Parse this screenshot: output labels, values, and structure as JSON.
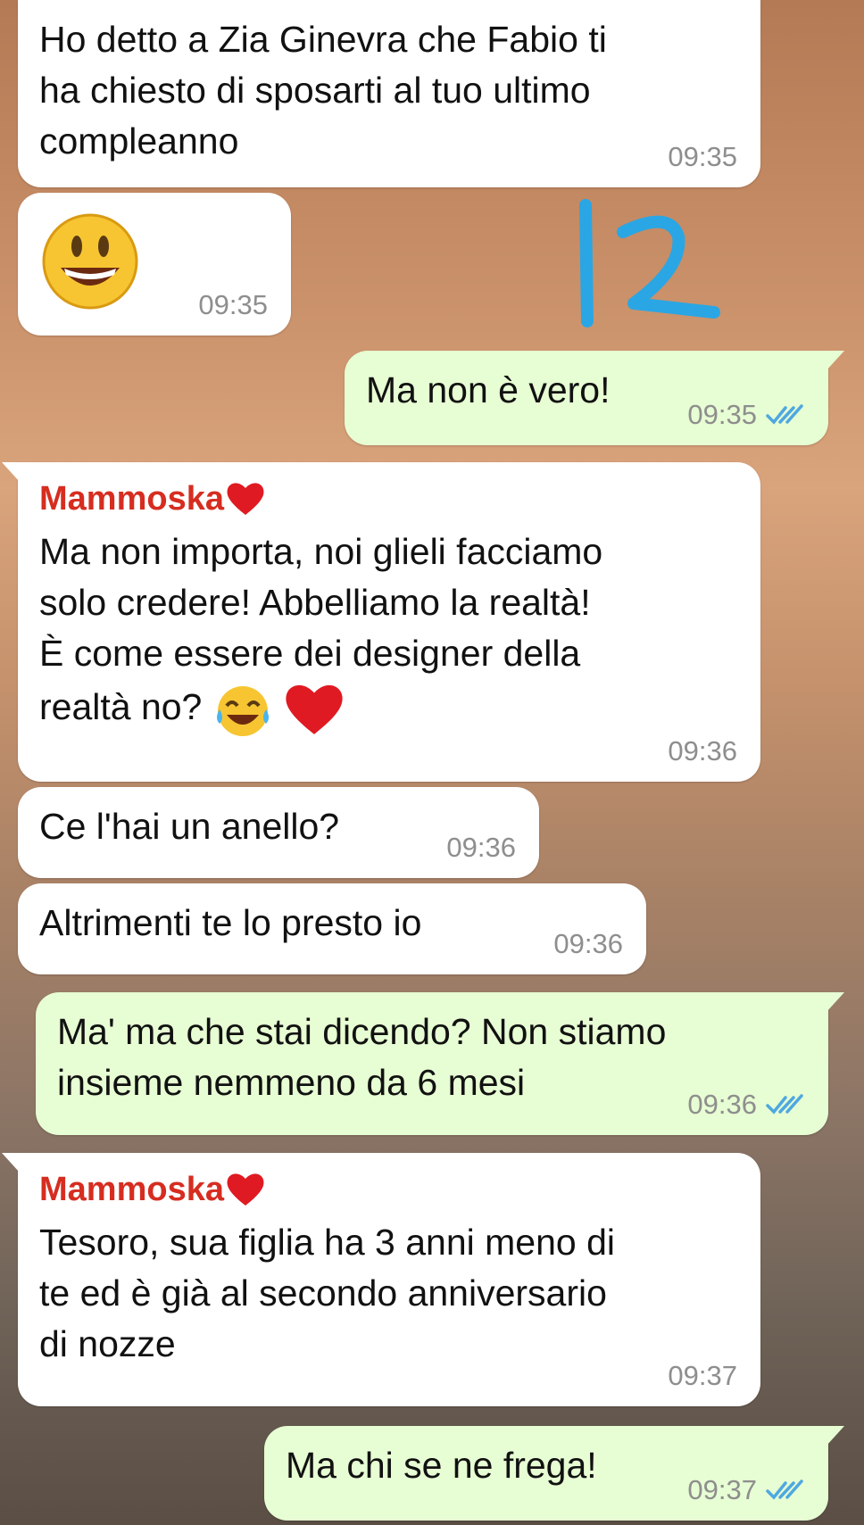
{
  "messages": [
    {
      "id": "m1",
      "type": "incoming",
      "text": "Ho detto a Zia Ginevra che Fabio ti\nha chiesto di sposarti al tuo ultimo\ncompleanno",
      "time": "09:35"
    },
    {
      "id": "m2",
      "type": "incoming",
      "emoji": "smiling-face-icon",
      "time": "09:35"
    },
    {
      "id": "m3",
      "type": "outgoing",
      "text": "Ma non è vero!",
      "time": "09:35",
      "status": "read"
    },
    {
      "id": "m4",
      "type": "incoming",
      "sender": "Mammoska",
      "text": "Ma non importa, noi glieli facciamo\nsolo credere! Abbelliamo la realtà!\nÈ come essere dei designer della\nrealtà no?",
      "emojis": [
        "tears-of-joy-icon",
        "red-heart-icon"
      ],
      "time": "09:36"
    },
    {
      "id": "m5",
      "type": "incoming",
      "text": "Ce l'hai un anello?",
      "time": "09:36"
    },
    {
      "id": "m6",
      "type": "incoming",
      "text": "Altrimenti te lo presto io",
      "time": "09:36"
    },
    {
      "id": "m7",
      "type": "outgoing",
      "text": "Ma' ma che stai dicendo? Non stiamo\ninsieme nemmeno da 6 mesi",
      "time": "09:36",
      "status": "read"
    },
    {
      "id": "m8",
      "type": "incoming",
      "sender": "Mammoska",
      "text": "Tesoro, sua figlia ha 3 anni meno di\nte ed è già al secondo anniversario\ndi nozze",
      "time": "09:37"
    },
    {
      "id": "m9",
      "type": "outgoing",
      "text": "Ma chi se ne frega!",
      "time": "09:37",
      "status": "read"
    }
  ],
  "annotation": {
    "text": "12",
    "color": "#2aa6e4"
  },
  "colors": {
    "incoming": "#ffffff",
    "outgoing": "#e7fdd3",
    "sender": "#d62d20",
    "read_ticks": "#4fa8e0",
    "timestamp": "#8e8e8e"
  }
}
